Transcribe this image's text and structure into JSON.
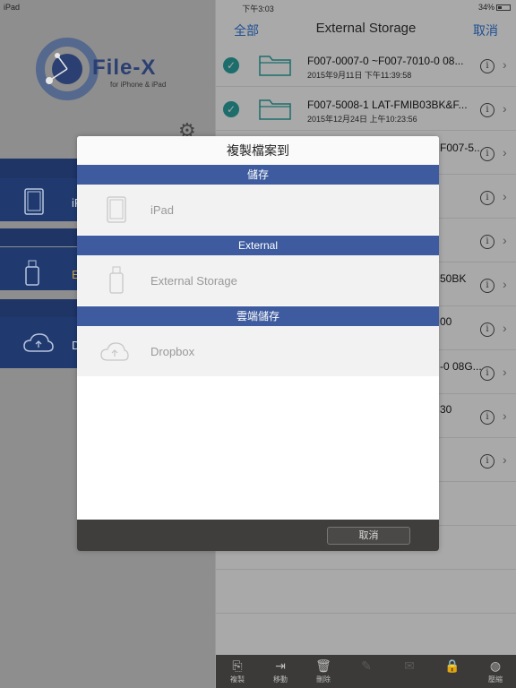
{
  "status_bar": {
    "device": "iPad",
    "time": "下午3:03",
    "battery": "34%"
  },
  "left_pane": {
    "brand": "File-X",
    "brand_sub": "for iPhone & iPad",
    "nav": [
      {
        "label": "iPad",
        "icon": "ipad-icon"
      },
      {
        "label": "External Storage",
        "icon": "usb-drive-icon"
      },
      {
        "label": "Dropbox",
        "icon": "cloud-icon"
      }
    ],
    "nav_visible": [
      "iP",
      "E",
      "D"
    ]
  },
  "right_pane": {
    "header": {
      "all_label": "全部",
      "title": "External Storage",
      "cancel_label": "取消"
    },
    "rows": [
      {
        "name": "F007-0007-0  ~F007-7010-0 08...",
        "date": "2015年9月11日 下午11:39:58"
      },
      {
        "name": "F007-5008-1   LAT-FMIB03BK&F...",
        "date": "2015年12月24日 上午10:23:56"
      }
    ],
    "partial_texts": [
      "F007-5...",
      "50BK",
      "00",
      "-0 08G...",
      "30"
    ]
  },
  "toolbar": {
    "items": [
      {
        "label": "複製",
        "icon": "copy-icon"
      },
      {
        "label": "移動",
        "icon": "move-icon"
      },
      {
        "label": "刪除",
        "icon": "trash-icon"
      },
      {
        "label": "",
        "icon": "edit-icon"
      },
      {
        "label": "",
        "icon": "mail-icon"
      },
      {
        "label": "",
        "icon": "lock-icon"
      },
      {
        "label": "壓縮",
        "icon": "compress-icon"
      }
    ]
  },
  "modal": {
    "title": "複製檔案到",
    "sections": [
      {
        "header": "儲存",
        "option": "iPad"
      },
      {
        "header": "External",
        "option": "External Storage"
      },
      {
        "header": "雲端儲存",
        "option": "Dropbox"
      }
    ],
    "cancel_label": "取消"
  },
  "colors": {
    "navy": "#203a70",
    "section_blue": "#3d5b9e",
    "check_teal": "#1c6d6b"
  }
}
